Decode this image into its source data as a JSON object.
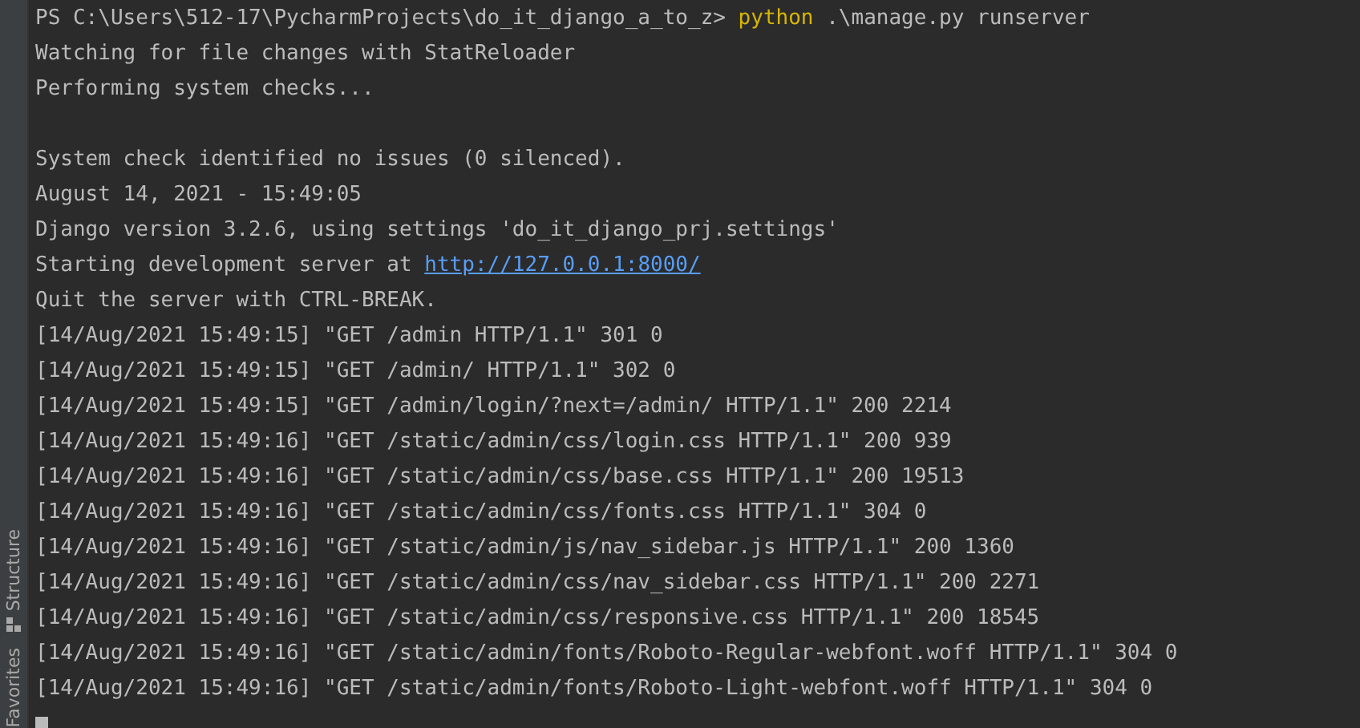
{
  "sidebar": {
    "tabs": [
      {
        "label": "Structure",
        "kind": "structure"
      },
      {
        "label": "Favorites",
        "kind": "plain"
      }
    ]
  },
  "terminal": {
    "lines": [
      {
        "kind": "prompt",
        "prompt": "PS C:\\Users\\512-17\\PycharmProjects\\do_it_django_a_to_z> ",
        "command": "python",
        "args": " .\\manage.py runserver"
      },
      {
        "kind": "text",
        "text": "Watching for file changes with StatReloader"
      },
      {
        "kind": "text",
        "text": "Performing system checks..."
      },
      {
        "kind": "blank"
      },
      {
        "kind": "text",
        "text": "System check identified no issues (0 silenced)."
      },
      {
        "kind": "text",
        "text": "August 14, 2021 - 15:49:05"
      },
      {
        "kind": "text",
        "text": "Django version 3.2.6, using settings 'do_it_django_prj.settings'"
      },
      {
        "kind": "link",
        "text": "Starting development server at ",
        "link": "http://127.0.0.1:8000/"
      },
      {
        "kind": "text",
        "text": "Quit the server with CTRL-BREAK."
      },
      {
        "kind": "text",
        "text": "[14/Aug/2021 15:49:15] \"GET /admin HTTP/1.1\" 301 0"
      },
      {
        "kind": "text",
        "text": "[14/Aug/2021 15:49:15] \"GET /admin/ HTTP/1.1\" 302 0"
      },
      {
        "kind": "text",
        "text": "[14/Aug/2021 15:49:15] \"GET /admin/login/?next=/admin/ HTTP/1.1\" 200 2214"
      },
      {
        "kind": "text",
        "text": "[14/Aug/2021 15:49:16] \"GET /static/admin/css/login.css HTTP/1.1\" 200 939"
      },
      {
        "kind": "text",
        "text": "[14/Aug/2021 15:49:16] \"GET /static/admin/css/base.css HTTP/1.1\" 200 19513"
      },
      {
        "kind": "text",
        "text": "[14/Aug/2021 15:49:16] \"GET /static/admin/css/fonts.css HTTP/1.1\" 304 0"
      },
      {
        "kind": "text",
        "text": "[14/Aug/2021 15:49:16] \"GET /static/admin/js/nav_sidebar.js HTTP/1.1\" 200 1360"
      },
      {
        "kind": "text",
        "text": "[14/Aug/2021 15:49:16] \"GET /static/admin/css/nav_sidebar.css HTTP/1.1\" 200 2271"
      },
      {
        "kind": "text",
        "text": "[14/Aug/2021 15:49:16] \"GET /static/admin/css/responsive.css HTTP/1.1\" 200 18545"
      },
      {
        "kind": "text",
        "text": "[14/Aug/2021 15:49:16] \"GET /static/admin/fonts/Roboto-Regular-webfont.woff HTTP/1.1\" 304 0"
      },
      {
        "kind": "text",
        "text": "[14/Aug/2021 15:49:16] \"GET /static/admin/fonts/Roboto-Light-webfont.woff HTTP/1.1\" 304 0"
      },
      {
        "kind": "cursor"
      }
    ]
  }
}
